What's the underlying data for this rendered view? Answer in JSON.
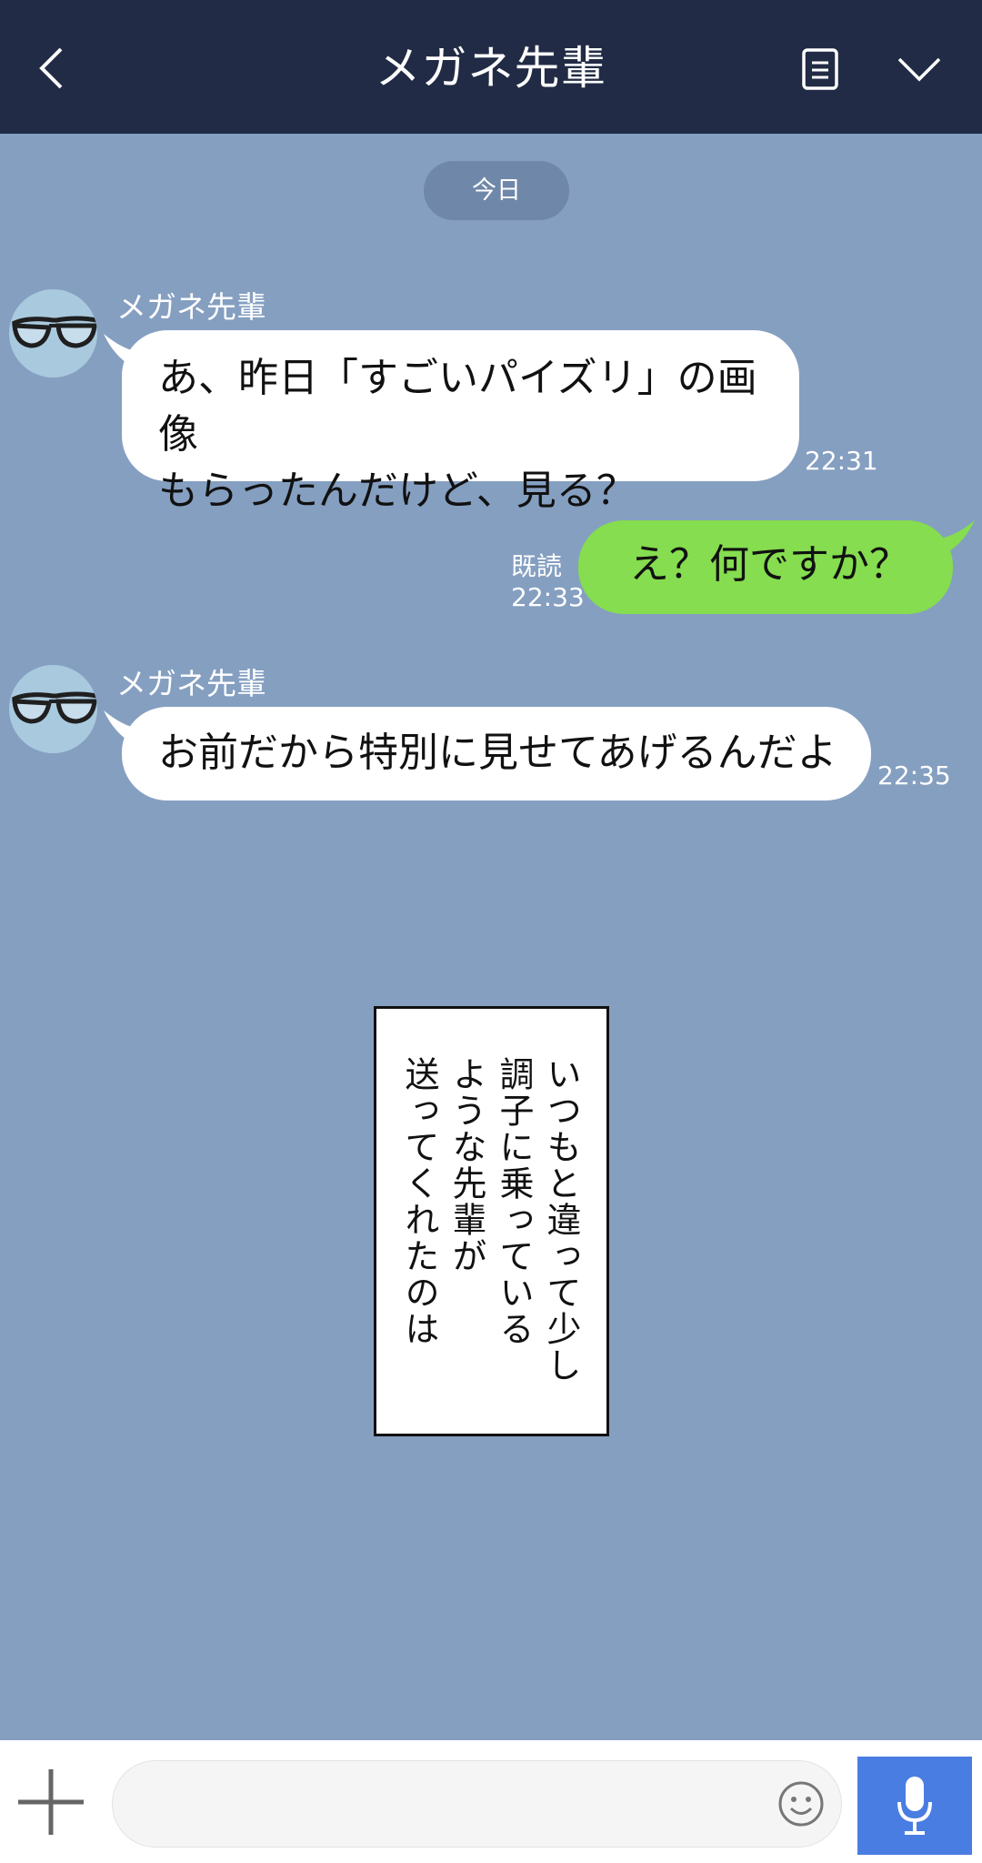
{
  "header": {
    "title": "メガネ先輩",
    "back_icon": "chevron-left-icon",
    "notes_icon": "notes-icon",
    "menu_icon": "chevron-down-icon"
  },
  "date_separator": "今日",
  "messages": [
    {
      "direction": "in",
      "sender": "メガネ先輩",
      "lines": [
        "あ、昨日「すごいパイズリ」の画像",
        "もらったんだけど、見る？"
      ],
      "time": "22:31"
    },
    {
      "direction": "out",
      "lines": [
        "え？何ですか？"
      ],
      "read": "既読",
      "time": "22:33"
    },
    {
      "direction": "in",
      "sender": "メガネ先輩",
      "lines": [
        "お前だから特別に見せてあげるんだよ"
      ],
      "time": "22:35"
    }
  ],
  "narration": {
    "columns": [
      "いつもと違って少し",
      "調子に乗っている",
      "ような先輩が",
      "送ってくれたのは"
    ]
  },
  "input_bar": {
    "placeholder": "",
    "plus_icon": "plus-icon",
    "emoji_icon": "smiley-icon",
    "mic_icon": "microphone-icon"
  },
  "colors": {
    "header_bg": "#212b45",
    "chat_bg": "#859fc1",
    "outgoing_bubble": "#85dd4f",
    "incoming_bubble": "#ffffff",
    "mic_button": "#4a7de2"
  }
}
